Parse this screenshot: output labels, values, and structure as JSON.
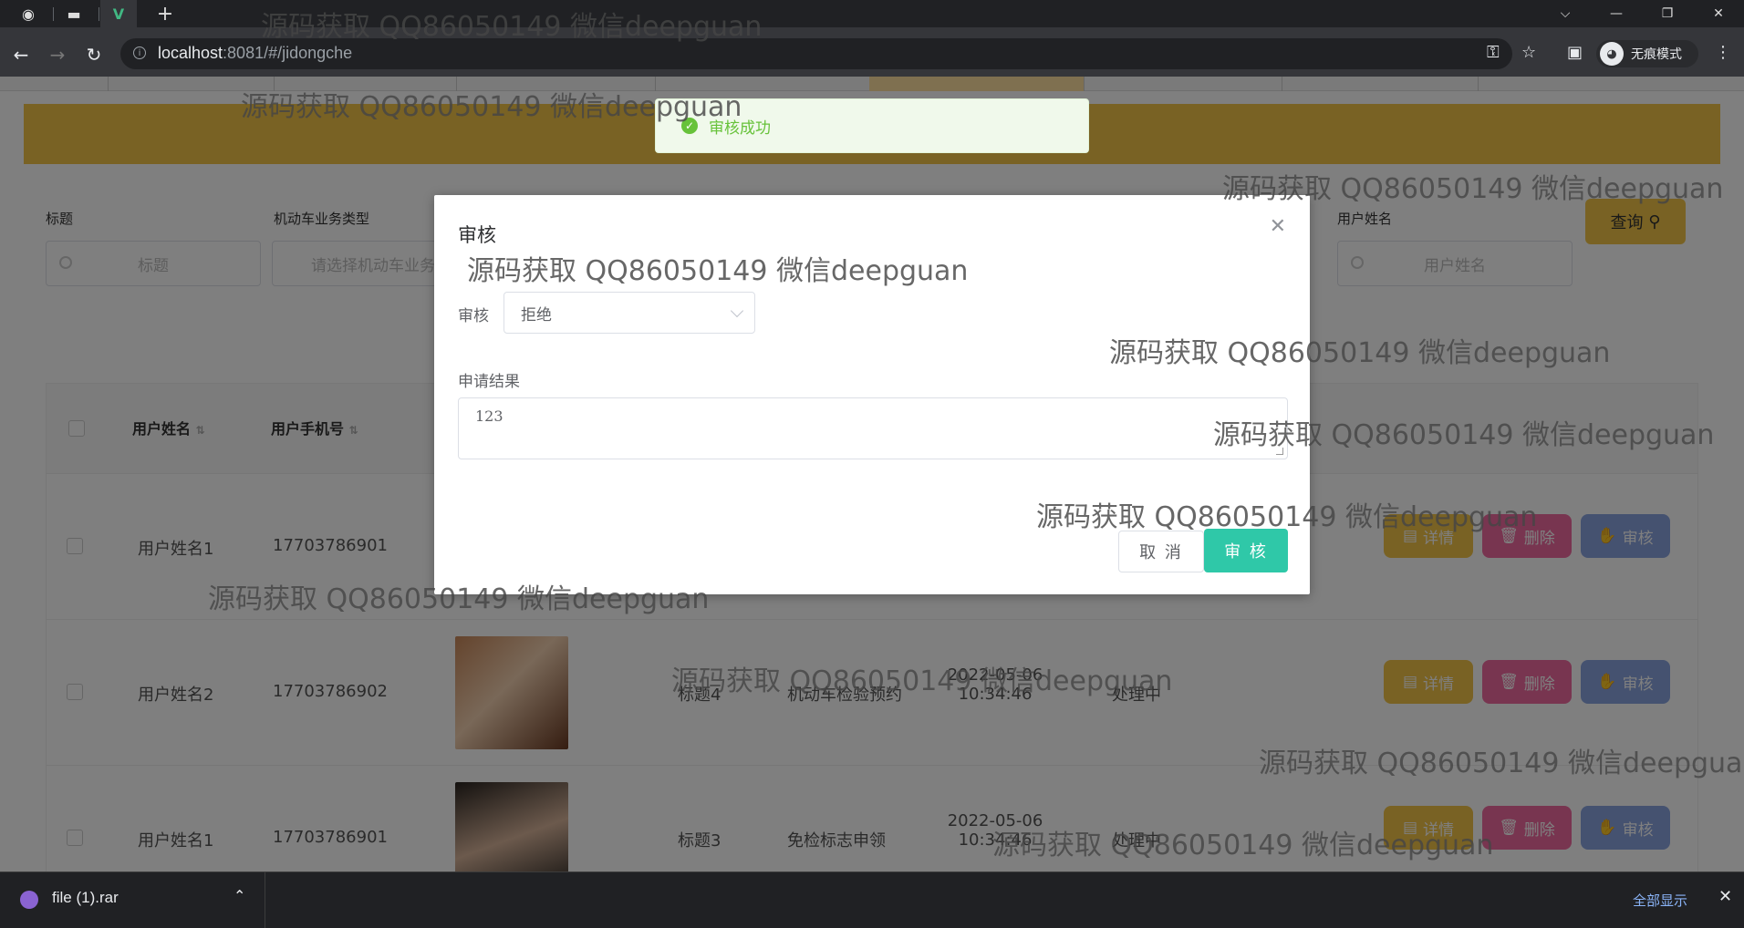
{
  "browser": {
    "url_host": "localhost",
    "url_rest": ":8081/#/jidongche",
    "incognito_label": "无痕模式",
    "window_controls": [
      "chevron-down",
      "minimize",
      "restore",
      "close"
    ]
  },
  "search": {
    "fields": [
      {
        "label": "标题",
        "placeholder": "标题"
      },
      {
        "label": "机动车业务类型",
        "placeholder": "请选择机动车业务"
      },
      {
        "label": "用户姓名",
        "placeholder": "用户姓名"
      }
    ],
    "query_button": "查询"
  },
  "table": {
    "headers": [
      "用户姓名",
      "用户手机号"
    ],
    "rows": [
      {
        "name": "用户姓名1",
        "phone": "17703786901",
        "title": "",
        "type": "",
        "time": "",
        "status": ""
      },
      {
        "name": "用户姓名2",
        "phone": "17703786902",
        "title": "标题4",
        "type": "机动车检验预约",
        "time": "2022-05-06 10:34:46",
        "status": "处理中"
      },
      {
        "name": "用户姓名1",
        "phone": "17703786901",
        "title": "标题3",
        "type": "免检标志申领",
        "time": "2022-05-06 10:34:46",
        "status": "处理中"
      }
    ],
    "row_actions": {
      "detail": "详情",
      "delete": "删除",
      "audit": "审核"
    }
  },
  "dialog": {
    "title": "审核",
    "audit_label": "审核",
    "audit_value": "拒绝",
    "result_label": "申请结果",
    "result_value": "123",
    "cancel": "取 消",
    "confirm": "审 核"
  },
  "toast": {
    "message": "审核成功"
  },
  "watermark": "源码获取 QQ86050149 微信deepguan",
  "download": {
    "filename": "file (1).rar",
    "show_all": "全部显示"
  }
}
